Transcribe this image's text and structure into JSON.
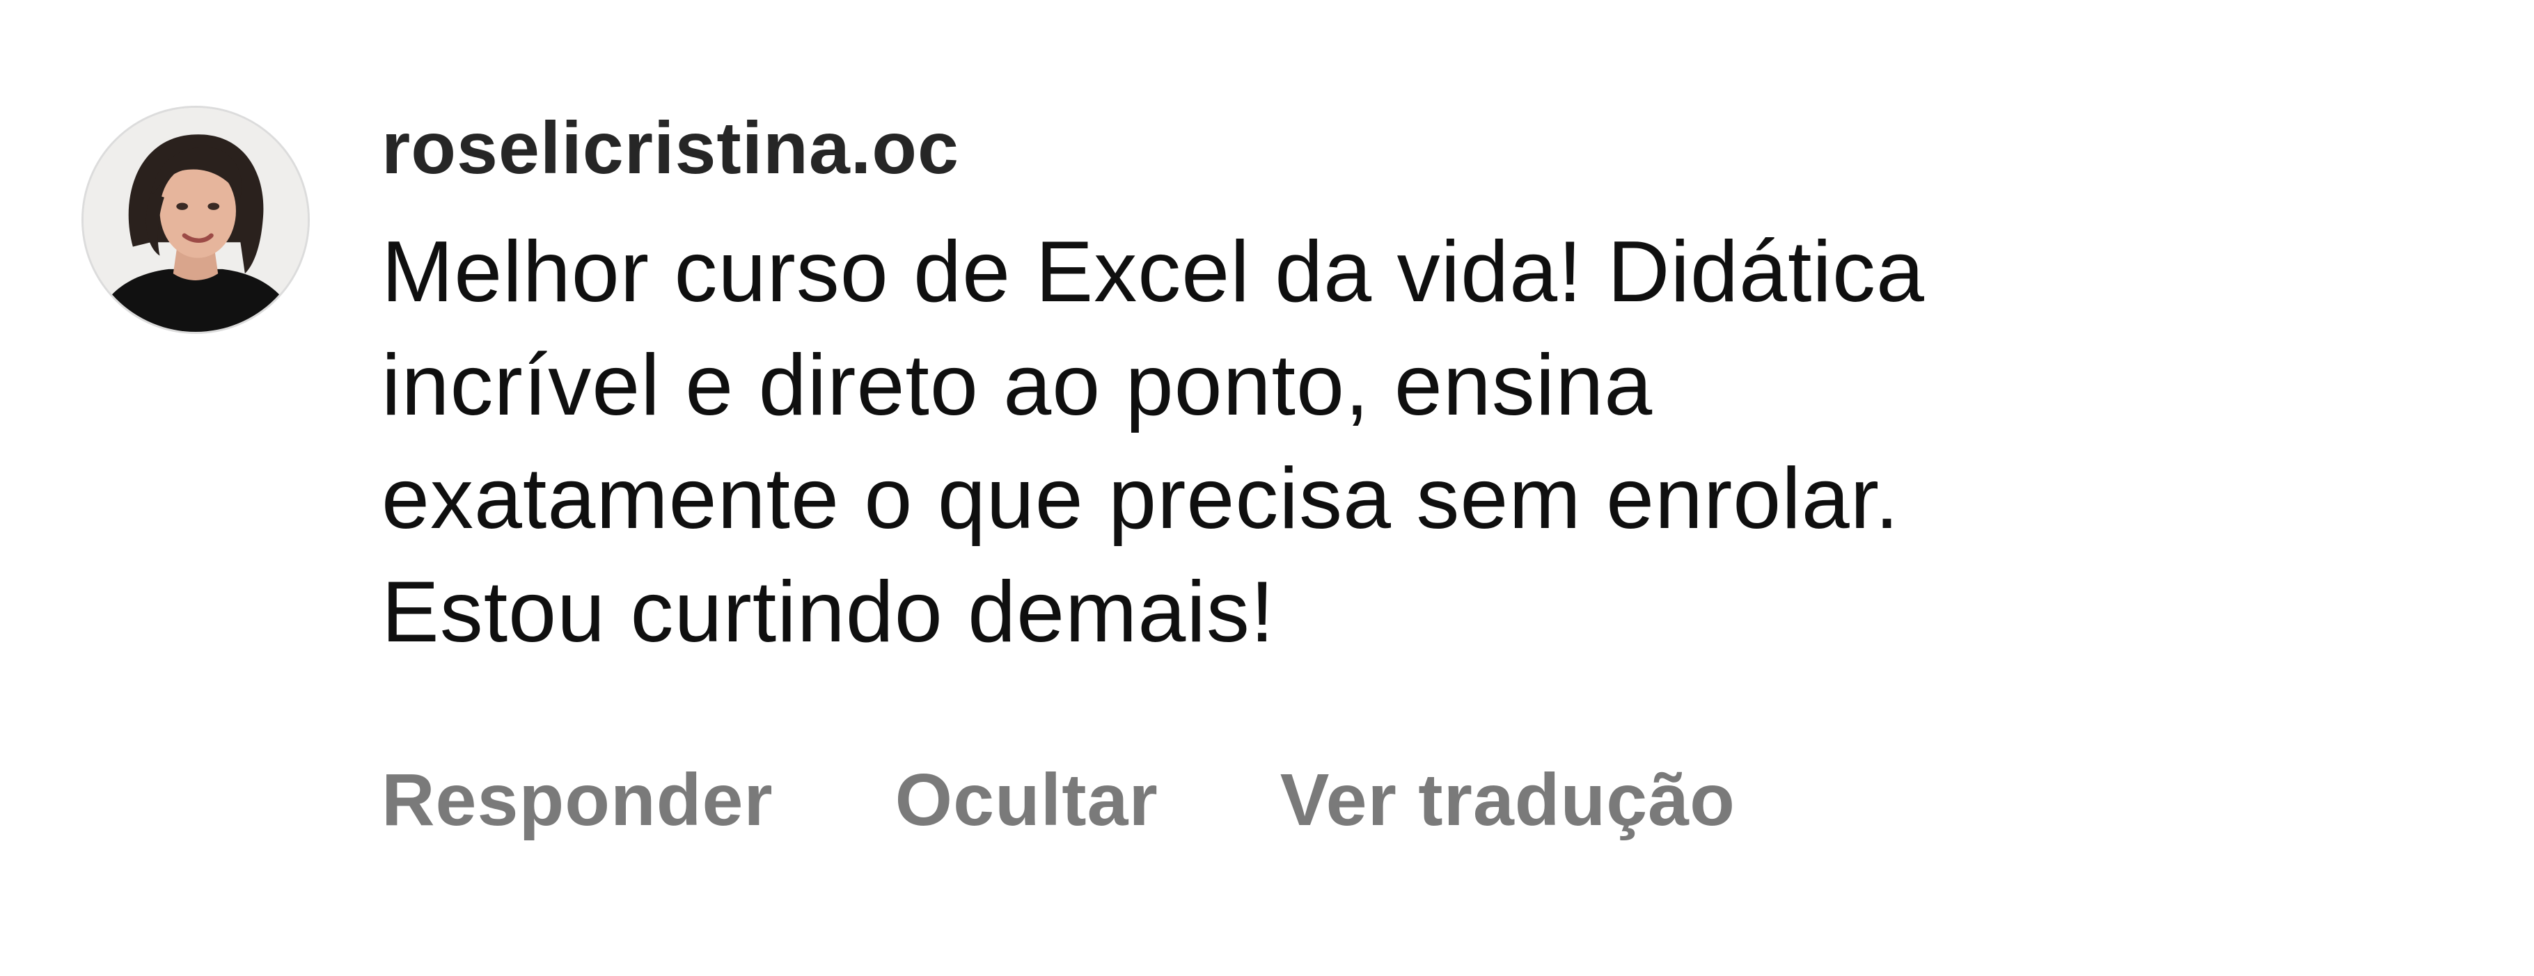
{
  "comment": {
    "username": "roselicristina.oc",
    "text_lines": [
      "Melhor curso de Excel da vida! Didática",
      "incrível e direto ao ponto, ensina",
      "exatamente o que precisa sem enrolar.",
      "Estou curtindo demais!"
    ],
    "actions": {
      "reply": "Responder",
      "hide": "Ocultar",
      "translate": "Ver tradução"
    }
  },
  "colors": {
    "username": "#262626",
    "text": "#0f0f0f",
    "action": "#7a7a7a",
    "background": "#ffffff"
  },
  "icons": {
    "avatar": "profile-photo"
  }
}
